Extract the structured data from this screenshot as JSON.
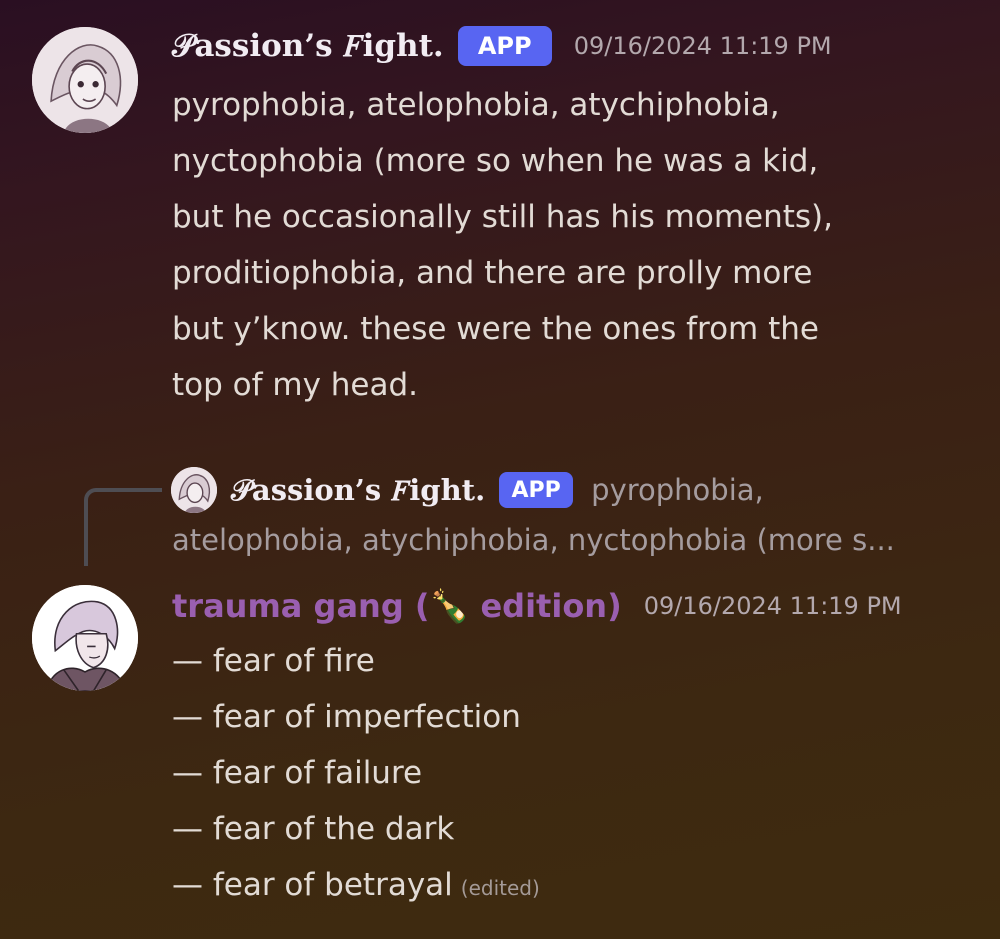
{
  "message1": {
    "author": "𝒫assion’s 𝐹ight.",
    "tag": "APP",
    "timestamp": "09/16/2024 11:19 PM",
    "lines": [
      "pyrophobia, atelophobia, atychiphobia,",
      "nyctophobia (more so when he was a kid,",
      "but he occasionally still has his moments),",
      "proditiophobia, and there are prolly more",
      "but y’know. these were the ones from the",
      "top of my head."
    ]
  },
  "reply_preview": {
    "author": "𝒫assion’s 𝐹ight.",
    "tag": "APP",
    "line1": "pyrophobia,",
    "line2": "atelophobia, atychiphobia, nyctophobia (more s..."
  },
  "message2": {
    "author_prefix": "trauma gang (",
    "author_emoji": "🍾",
    "author_suffix": " edition)",
    "timestamp": "09/16/2024 11:19 PM",
    "lines": [
      "— fear of fire",
      "— fear of imperfection",
      "— fear of failure",
      "— fear of the dark",
      "— fear of betrayal"
    ],
    "edited": "(edited)"
  },
  "colors": {
    "app_tag": "#5865f2",
    "trauma_name": "#9a5fb0"
  }
}
